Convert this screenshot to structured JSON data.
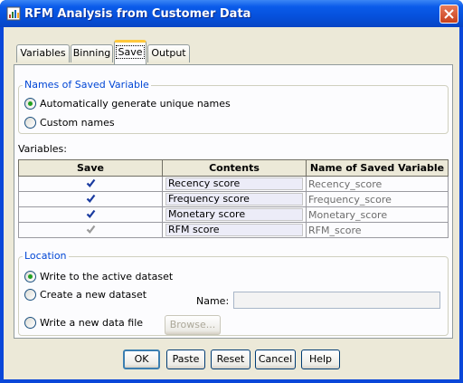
{
  "window": {
    "title": "RFM Analysis from Customer Data"
  },
  "tabs": [
    {
      "label": "Variables",
      "active": false
    },
    {
      "label": "Binning",
      "active": false
    },
    {
      "label": "Save",
      "active": true
    },
    {
      "label": "Output",
      "active": false
    }
  ],
  "names_group": {
    "title": "Names of Saved Variable",
    "auto_label": "Automatically generate unique names",
    "custom_label": "Custom names",
    "selected": "auto"
  },
  "variables": {
    "label": "Variables:",
    "columns": [
      "Save",
      "Contents",
      "Name of Saved Variable"
    ],
    "rows": [
      {
        "save": true,
        "enabled": true,
        "contents": "Recency score",
        "name": "Recency_score"
      },
      {
        "save": true,
        "enabled": true,
        "contents": "Frequency score",
        "name": "Frequency_score"
      },
      {
        "save": true,
        "enabled": true,
        "contents": "Monetary score",
        "name": "Monetary_score"
      },
      {
        "save": true,
        "enabled": false,
        "contents": "RFM score",
        "name": "RFM_score"
      }
    ]
  },
  "location": {
    "title": "Location",
    "write_active": "Write to the active dataset",
    "create_new": "Create a new dataset",
    "write_file": "Write a new data file",
    "name_label": "Name:",
    "name_value": "",
    "browse_label": "Browse...",
    "selected": "active"
  },
  "buttons": {
    "ok": "OK",
    "paste": "Paste",
    "reset": "Reset",
    "cancel": "Cancel",
    "help": "Help"
  },
  "colors": {
    "title_bar": "#0a5bea",
    "group_title": "#0046d5",
    "check_mark": "#1a3ba0",
    "radio_dot": "#21a121"
  }
}
